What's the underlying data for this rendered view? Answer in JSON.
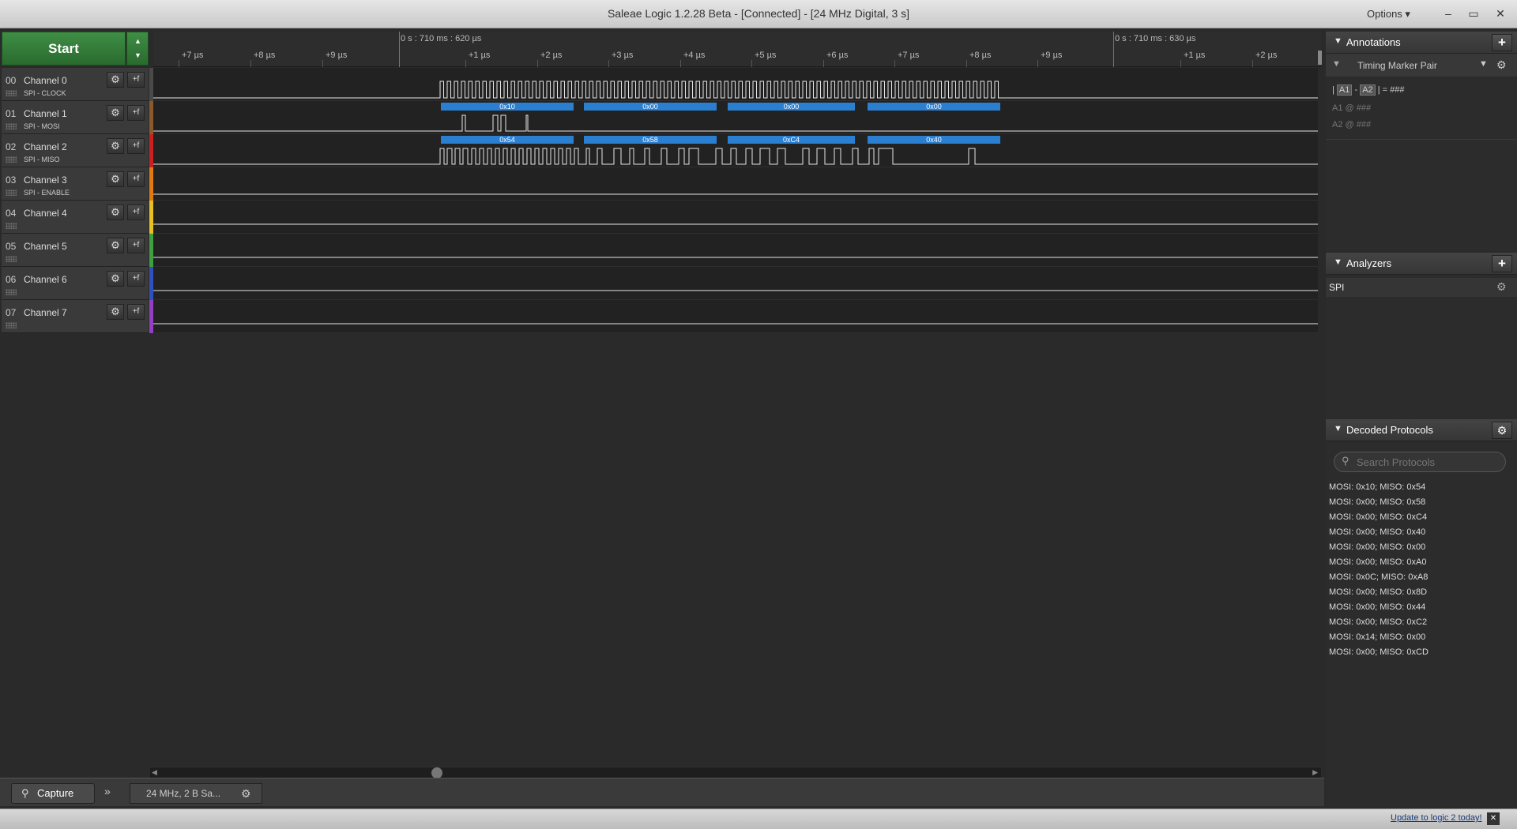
{
  "window": {
    "title": "Saleae Logic 1.2.28 Beta - [Connected] - [24 MHz Digital, 3 s]",
    "options_label": "Options ▾",
    "minimize": "–",
    "maximize": "▭",
    "close": "✕"
  },
  "start": {
    "label": "Start",
    "up": "▲",
    "down": "▼"
  },
  "channels": [
    {
      "num": "00",
      "name": "Channel 0",
      "sub": "SPI - CLOCK",
      "color": "#4a4a4a"
    },
    {
      "num": "01",
      "name": "Channel 1",
      "sub": "SPI - MOSI",
      "color": "#8b5a2b"
    },
    {
      "num": "02",
      "name": "Channel 2",
      "sub": "SPI - MISO",
      "color": "#cc2020"
    },
    {
      "num": "03",
      "name": "Channel 3",
      "sub": "SPI - ENABLE",
      "color": "#e07a10"
    },
    {
      "num": "04",
      "name": "Channel 4",
      "sub": "",
      "color": "#e8c020"
    },
    {
      "num": "05",
      "name": "Channel 5",
      "sub": "",
      "color": "#40a040"
    },
    {
      "num": "06",
      "name": "Channel 6",
      "sub": "",
      "color": "#3050c0"
    },
    {
      "num": "07",
      "name": "Channel 7",
      "sub": "",
      "color": "#9040c0"
    }
  ],
  "channel_buttons": {
    "gear": "⚙",
    "trigger": "+f"
  },
  "ruler": {
    "marker_left": "0 s : 710 ms : 620 µs",
    "marker_right": "0 s : 710 ms : 630 µs",
    "ticks": [
      "+7 µs",
      "+8 µs",
      "+9 µs",
      "+1 µs",
      "+2 µs",
      "+3 µs",
      "+4 µs",
      "+5 µs",
      "+6 µs",
      "+7 µs",
      "+8 µs",
      "+9 µs",
      "+1 µs",
      "+2 µs"
    ]
  },
  "mosi_frames": [
    "0x10",
    "0x00",
    "0x00",
    "0x00"
  ],
  "miso_frames": [
    "0x54",
    "0x58",
    "0xC4",
    "0x40"
  ],
  "bottom": {
    "capture_label": "Capture",
    "expand": "»",
    "sample_info": "24 MHz, 2 B Sa...",
    "settings_icon": "⚙",
    "update_link": "Update to logic 2 today!",
    "status_close": "✕"
  },
  "annotations": {
    "header": "Annotations",
    "add": "+",
    "marker_pair": "Timing Marker Pair",
    "a1": "A1",
    "a2": "A2",
    "formula_sep": "-",
    "formula_eq": "= ###",
    "a1_row": "A1  @  ###",
    "a2_row": "A2  @  ###"
  },
  "analyzers": {
    "header": "Analyzers",
    "add": "+",
    "items": [
      "SPI"
    ]
  },
  "decoded": {
    "header": "Decoded Protocols",
    "search_placeholder": "Search Protocols",
    "items": [
      "MOSI: 0x10;  MISO: 0x54",
      "MOSI: 0x00;  MISO: 0x58",
      "MOSI: 0x00;  MISO: 0xC4",
      "MOSI: 0x00;  MISO: 0x40",
      "MOSI: 0x00;  MISO: 0x00",
      "MOSI: 0x00;  MISO: 0xA0",
      "MOSI: 0x0C;  MISO: 0xA8",
      "MOSI: 0x00;  MISO: 0x8D",
      "MOSI: 0x00;  MISO: 0x44",
      "MOSI: 0x00;  MISO: 0xC2",
      "MOSI: 0x14;  MISO: 0x00",
      "MOSI: 0x00;  MISO: 0xCD"
    ]
  }
}
